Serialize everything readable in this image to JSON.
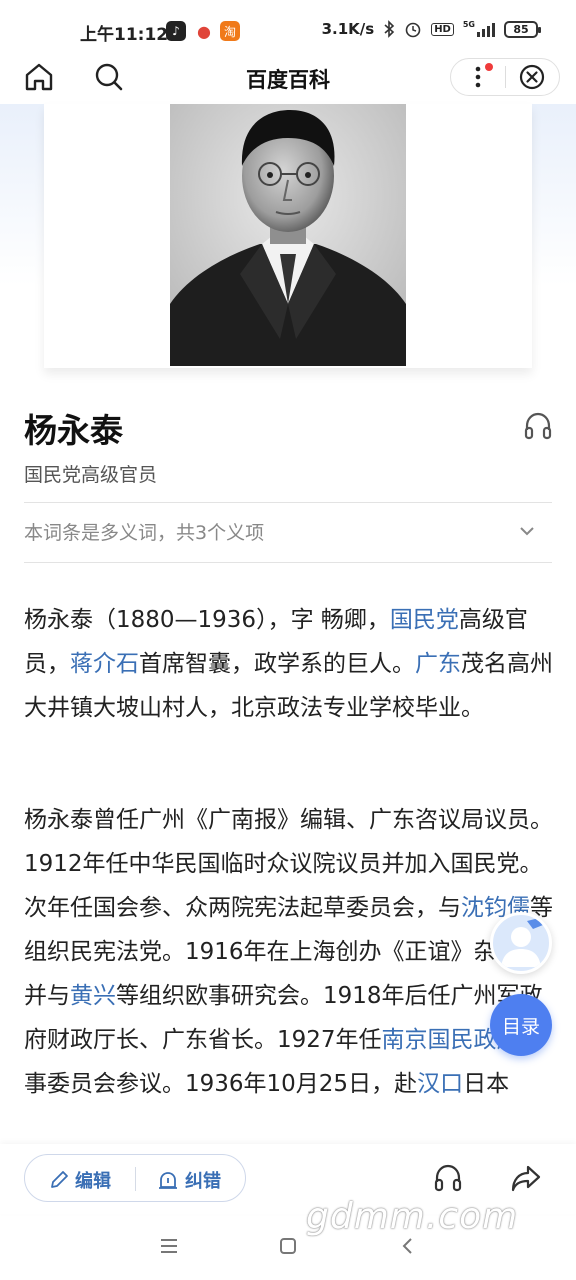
{
  "status_bar": {
    "time": "上午11:12",
    "speed": "3.1K/s",
    "network": "5G",
    "battery": "85"
  },
  "navbar": {
    "title": "百度百科"
  },
  "entry": {
    "title": "杨永泰",
    "subtitle": "国民党高级官员",
    "polysemy": "本词条是多义词，共3个义项"
  },
  "paragraph1": [
    {
      "t": "杨永泰（1880—1936），字 畅卿，",
      "link": false
    },
    {
      "t": "国民党",
      "link": true
    },
    {
      "t": "高级官员，",
      "link": false
    },
    {
      "t": "蒋介石",
      "link": true
    },
    {
      "t": "首席智囊，政学系的巨人。",
      "link": false
    },
    {
      "t": "广东",
      "link": true
    },
    {
      "t": "茂名高州大井镇大坡山村人，北京政法专业学校毕业。",
      "link": false
    }
  ],
  "paragraph2": [
    {
      "t": "杨永泰曾任广州《广南报》编辑、广东咨议局议员。1912年任中华民国临时众议院议员并加入国民党。次年任国会参、众两院宪法起草委员会，与",
      "link": false
    },
    {
      "t": "沈钧儒",
      "link": true
    },
    {
      "t": "等组织民宪法党。1916年在上海创办《正谊》杂志，并与",
      "link": false
    },
    {
      "t": "黄兴",
      "link": true
    },
    {
      "t": "等组织欧事研究会。1918年后任广州军政府财政厅长、广东省长。1927年任",
      "link": false
    },
    {
      "t": "南京国民政府",
      "link": true
    },
    {
      "t": "军事委员会参议。1936年10月25日，赴",
      "link": false
    },
    {
      "t": "汉口",
      "link": true
    },
    {
      "t": "日本",
      "link": false
    }
  ],
  "floating": {
    "toc_label": "目录"
  },
  "bottom_bar": {
    "edit_label": "编辑",
    "fix_label": "纠错"
  },
  "watermark": "gdmm.com",
  "colors": {
    "link": "#3a6fb5",
    "accent": "#4e7ff0"
  }
}
